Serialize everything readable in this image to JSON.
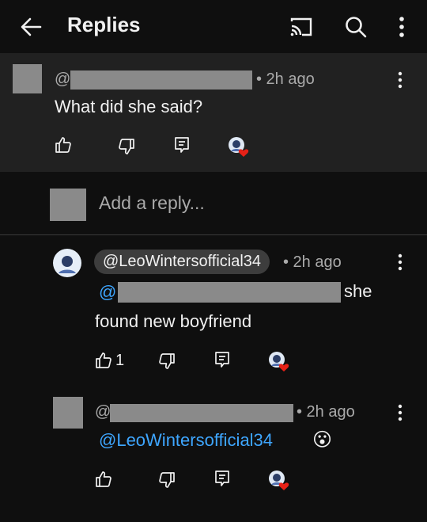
{
  "topbar": {
    "title": "Replies"
  },
  "parent_comment": {
    "handle_prefix": "@",
    "time": "• 2h ago",
    "text": "What did she said?"
  },
  "reply_input": {
    "placeholder": "Add a reply..."
  },
  "replies": [
    {
      "author": "@LeoWintersofficial34",
      "time": "• 2h ago",
      "mention_prefix": "@",
      "text_line1_suffix": "she",
      "text_line2": "found new boyfriend",
      "like_count": "1"
    },
    {
      "handle_prefix": "@",
      "time": "• 2h ago",
      "mention": "@LeoWintersofficial34",
      "emoji": "😮"
    }
  ],
  "colors": {
    "background": "#0f0f0f",
    "highlight": "#212121",
    "mention": "#3ea6ff",
    "heart": "#e62117"
  },
  "icons": [
    "back-arrow-icon",
    "cast-icon",
    "search-icon",
    "more-vert-icon",
    "like-icon",
    "dislike-icon",
    "reply-icon",
    "creator-heart-icon"
  ]
}
